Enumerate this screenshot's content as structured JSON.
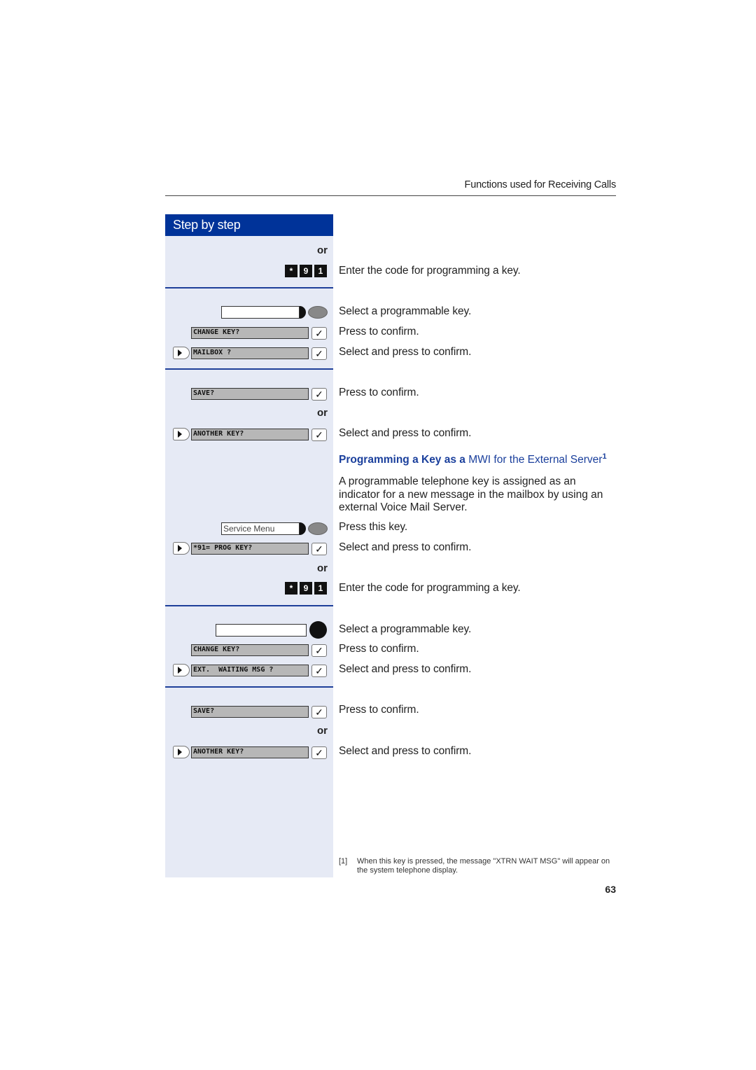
{
  "header": {
    "running_title": "Functions used for Receiving Calls"
  },
  "sidebar": {
    "title": "Step by step",
    "or_label": "or"
  },
  "keypad_code": [
    "*",
    "9",
    "1"
  ],
  "blocks": {
    "b1": {
      "code_text": "Enter the code for programming a key."
    },
    "b2": {
      "select_key_text": "Select a programmable key.",
      "display_1": "CHANGE KEY?",
      "display_1_text": "Press to confirm.",
      "display_2": "MAILBOX ?",
      "display_2_text": "Select and press to confirm."
    },
    "b3": {
      "display_1": "SAVE?",
      "display_1_text": "Press to confirm.",
      "display_2": "ANOTHER KEY?",
      "display_2_text": "Select and press to confirm."
    },
    "section": {
      "heading_bold": "Programming a Key as a",
      "heading_rest": "MWI for the External Server",
      "footnote_ref": "1",
      "paragraph": "A programmable telephone key is assigned as an indicator for a new message in the mailbox by using an external Voice Mail Server."
    },
    "b4": {
      "service_key_label": "Service Menu",
      "service_key_text": "Press this key.",
      "display_1": "*91= PROG KEY?",
      "display_1_text": "Select and press to confirm.",
      "code_text": "Enter the code for programming a key."
    },
    "b5": {
      "select_key_text": "Select a programmable key.",
      "display_1": "CHANGE KEY?",
      "display_1_text": "Press to confirm.",
      "display_2": "EXT.  WAITING MSG ?",
      "display_2_text": "Select and press to confirm."
    },
    "b6": {
      "display_1": "SAVE?",
      "display_1_text": "Press to confirm.",
      "display_2": "ANOTHER KEY?",
      "display_2_text": "Select and press to confirm."
    }
  },
  "footnote": {
    "number": "[1]",
    "text": "When this key is pressed, the message \"XTRN WAIT MSG\" will appear on the system telephone display."
  },
  "page_number": "63",
  "colors": {
    "brand_blue": "#003399",
    "sidebar_bg": "#e6eaf5",
    "heading_blue": "#1a3f9c"
  }
}
